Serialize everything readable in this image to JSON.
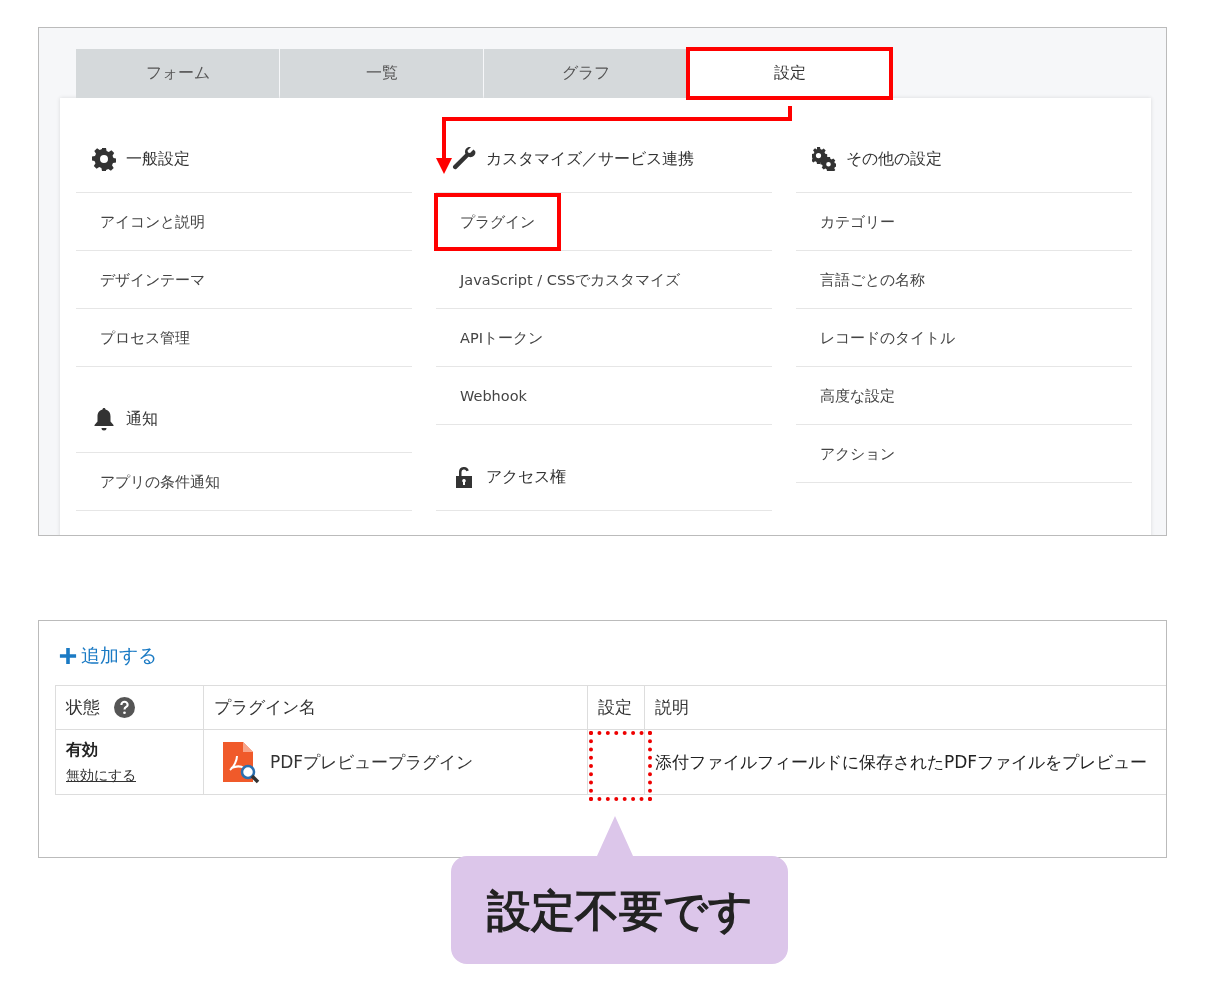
{
  "settings_tabs": [
    {
      "label": "フォーム",
      "selected": false,
      "highlighted": false
    },
    {
      "label": "一覧",
      "selected": false,
      "highlighted": false
    },
    {
      "label": "グラフ",
      "selected": false,
      "highlighted": false
    },
    {
      "label": "設定",
      "selected": true,
      "highlighted": true
    }
  ],
  "settings_columns": [
    {
      "sections": [
        {
          "title": "一般設定",
          "items": [
            {
              "label": "アイコンと説明",
              "highlighted": false
            },
            {
              "label": "デザインテーマ",
              "highlighted": false
            },
            {
              "label": "プロセス管理",
              "highlighted": false
            }
          ]
        },
        {
          "title": "通知",
          "items": [
            {
              "label": "アプリの条件通知",
              "highlighted": false
            }
          ]
        }
      ]
    },
    {
      "sections": [
        {
          "title": "カスタマイズ／サービス連携",
          "items": [
            {
              "label": "プラグイン",
              "highlighted": true
            },
            {
              "label": "JavaScript / CSSでカスタマイズ",
              "highlighted": false
            },
            {
              "label": "APIトークン",
              "highlighted": false
            },
            {
              "label": "Webhook",
              "highlighted": false
            }
          ]
        },
        {
          "title": "アクセス権"
        }
      ]
    },
    {
      "sections": [
        {
          "title": "その他の設定",
          "items": [
            {
              "label": "カテゴリー",
              "highlighted": false
            },
            {
              "label": "言語ごとの名称",
              "highlighted": false
            },
            {
              "label": "レコードのタイトル",
              "highlighted": false
            },
            {
              "label": "高度な設定",
              "highlighted": false
            },
            {
              "label": "アクション",
              "highlighted": false
            }
          ]
        }
      ]
    }
  ],
  "plugins": {
    "add_link": "追加する",
    "columns": [
      "状態",
      "プラグイン名",
      "設定",
      "説明"
    ],
    "rows": [
      {
        "status": "有効",
        "toggle_link": "無効にする",
        "name": "PDFプレビュープラグイン",
        "settings_highlighted": true,
        "description": "添付ファイルフィールドに保存されたPDFファイルをプレビュー"
      }
    ]
  },
  "callout": {
    "text": "設定不要です"
  }
}
